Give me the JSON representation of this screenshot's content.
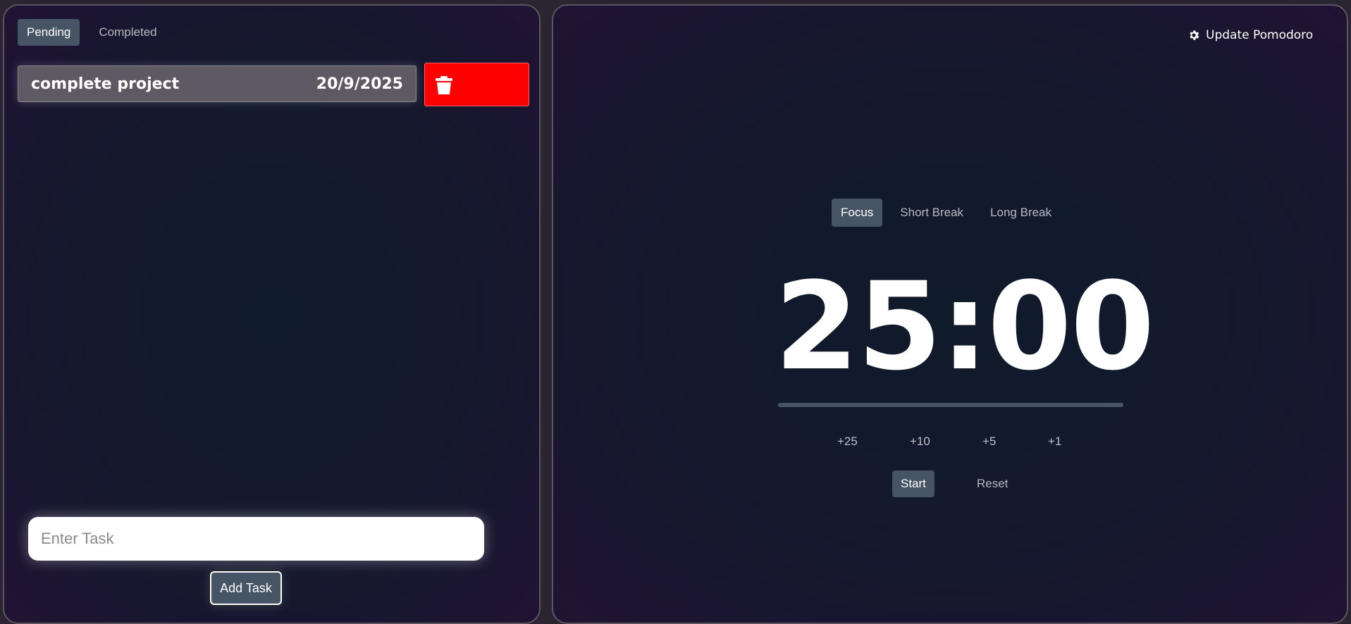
{
  "tasks_panel": {
    "tabs": [
      {
        "label": "Pending",
        "active": true
      },
      {
        "label": "Completed",
        "active": false
      }
    ],
    "tasks": [
      {
        "title": "complete project",
        "date": "20/9/2025"
      }
    ],
    "input": {
      "placeholder": "Enter Task",
      "value": ""
    },
    "add_button": "Add Task"
  },
  "timer_panel": {
    "settings_link": "Update Pomodoro",
    "settings_icon": "gear-icon",
    "modes": [
      {
        "label": "Focus",
        "active": true
      },
      {
        "label": "Short Break",
        "active": false
      },
      {
        "label": "Long Break",
        "active": false
      }
    ],
    "time": "25:00",
    "progress": 0,
    "add_time": [
      "+25",
      "+10",
      "+5",
      "+1"
    ],
    "start": "Start",
    "reset": "Reset"
  },
  "colors": {
    "active_tab": "#475466",
    "delete": "#ff0000"
  }
}
